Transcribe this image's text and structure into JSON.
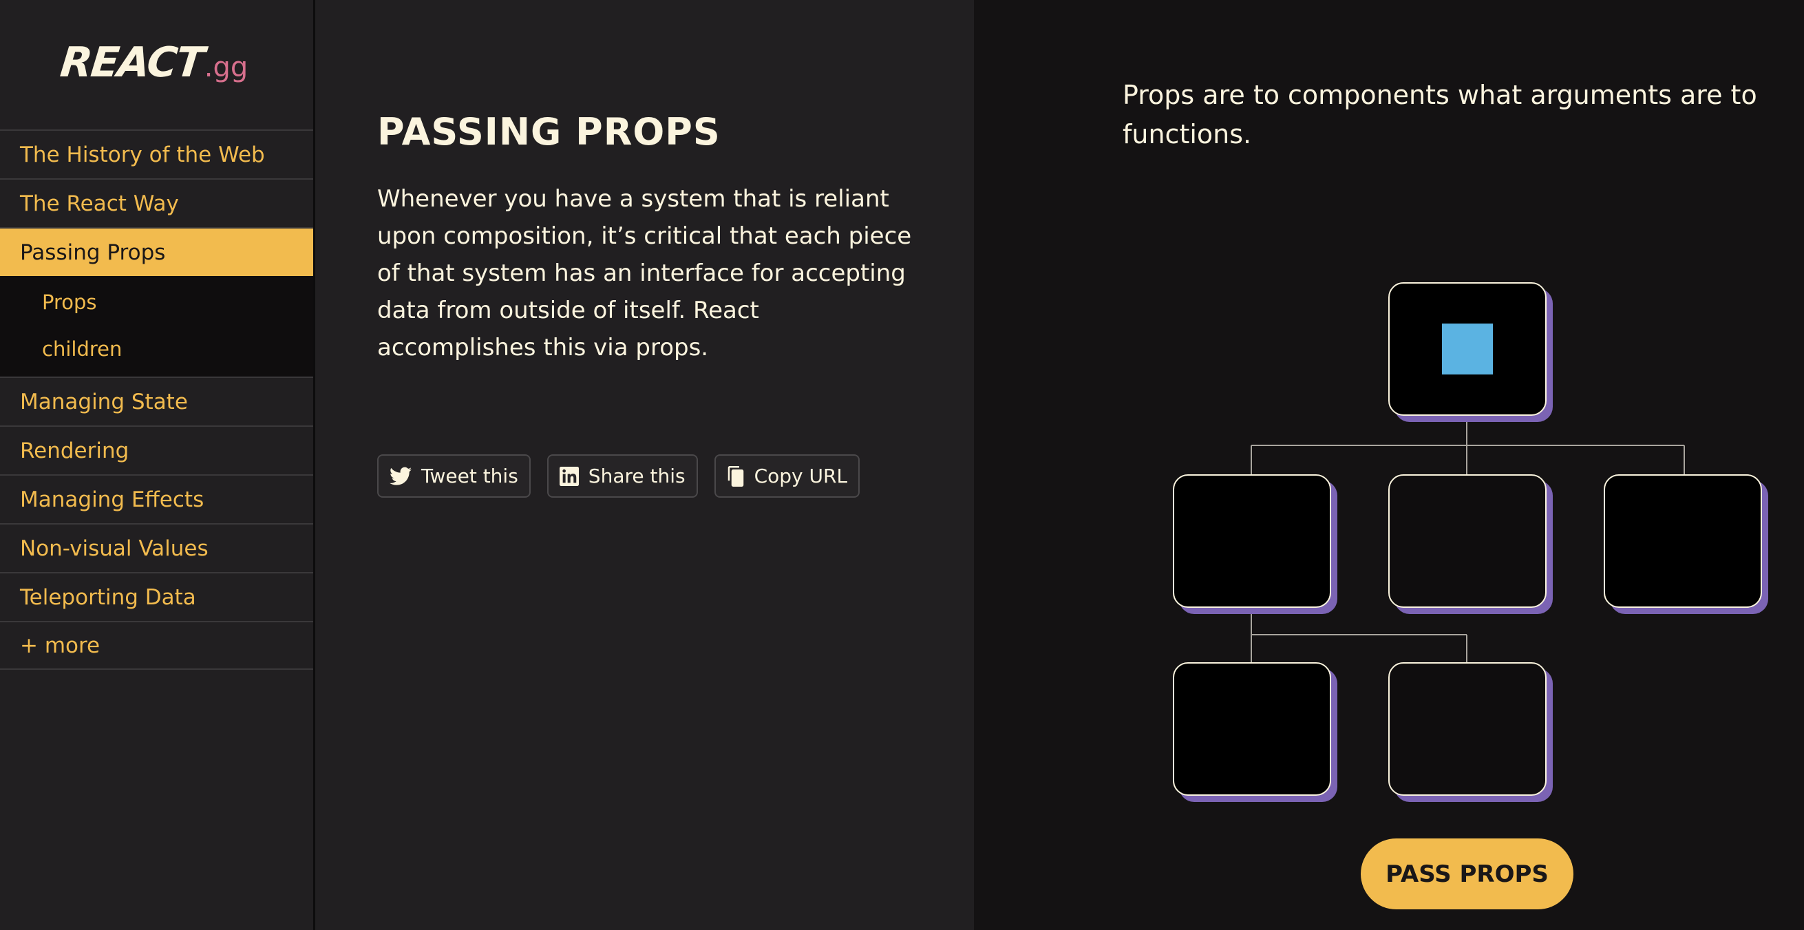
{
  "logo": {
    "main": "REACT",
    "suffix": ".gg"
  },
  "nav": {
    "items": [
      {
        "label": "The History of the Web"
      },
      {
        "label": "The React Way"
      },
      {
        "label": "Passing Props",
        "active": true
      },
      {
        "label": "Managing State"
      },
      {
        "label": "Rendering"
      },
      {
        "label": "Managing Effects"
      },
      {
        "label": "Non-visual Values"
      },
      {
        "label": "Teleporting Data"
      },
      {
        "label": "+ more"
      }
    ],
    "subitems": [
      {
        "label": "Props"
      },
      {
        "label": "children"
      }
    ]
  },
  "main": {
    "title": "PASSING PROPS",
    "intro": "Whenever you have a system that is reliant upon composition, it’s critical that each piece of that system has an interface for accepting data from outside of itself. React accomplishes this via props.",
    "share": {
      "tweet": "Tweet this",
      "linkedin": "Share this",
      "copy": "Copy URL"
    }
  },
  "demo": {
    "caption": "Props are to components what arguments are to functions.",
    "button_label": "PASS PROPS",
    "prop_color": "#5bb3e2",
    "shadow_color": "#7b63b4"
  },
  "colors": {
    "accent": "#f2bb4e",
    "text": "#fbf4de",
    "logo_suffix": "#d76f8d",
    "background": "#211f21",
    "demo_background": "#141213"
  }
}
